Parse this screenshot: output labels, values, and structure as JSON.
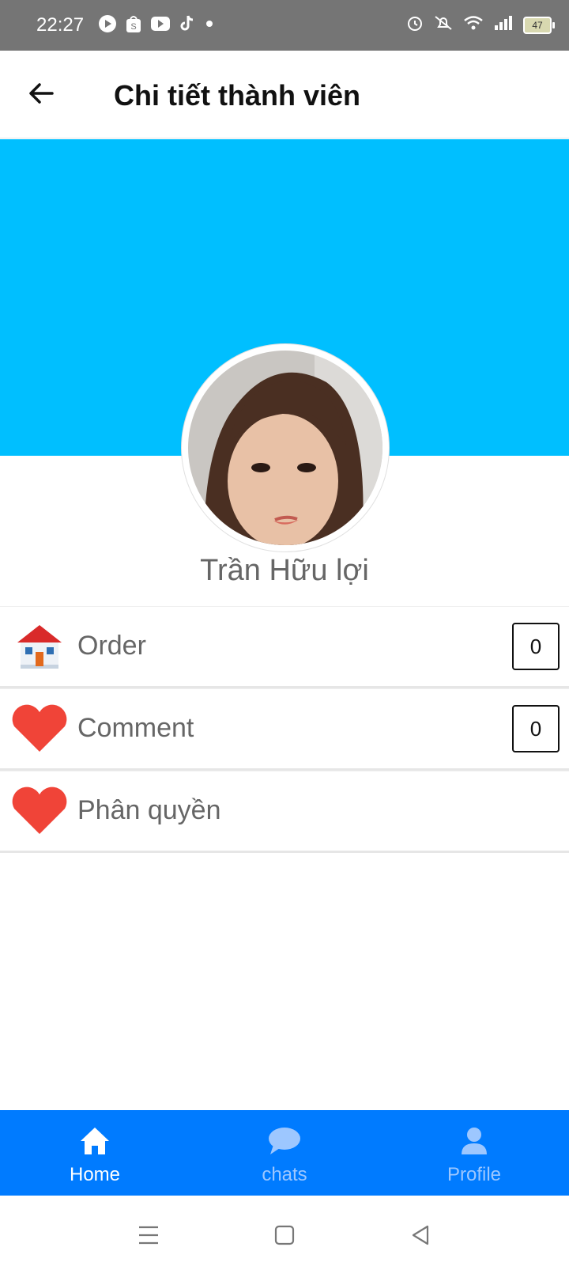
{
  "status_bar": {
    "time": "22:27",
    "battery": "47",
    "icons_left": [
      "play-icon",
      "shop-icon",
      "youtube-icon",
      "tiktok-icon",
      "dot-icon"
    ],
    "icons_right": [
      "alarm-icon",
      "mute-icon",
      "wifi-icon",
      "signal-icon",
      "battery-icon"
    ]
  },
  "app_bar": {
    "back_icon": "arrow-left-icon",
    "title": "Chi tiết thành viên"
  },
  "profile": {
    "name": "Trần Hữu lợi",
    "cover_color": "#00bfff"
  },
  "list": {
    "items": [
      {
        "label": "Order",
        "icon": "house-icon",
        "count": "0"
      },
      {
        "label": "Comment",
        "icon": "heart-icon",
        "count": "0"
      },
      {
        "label": "Phân quyền",
        "icon": "heart-icon"
      }
    ]
  },
  "bottom_nav": {
    "color": "#007bff",
    "items": [
      {
        "label": "Home",
        "icon": "home-icon",
        "active": true
      },
      {
        "label": "chats",
        "icon": "chat-bubble-icon",
        "active": false
      },
      {
        "label": "Profile",
        "icon": "person-icon",
        "active": false
      }
    ]
  },
  "system_nav": {
    "buttons": [
      "menu-icon",
      "square-home-icon",
      "triangle-back-icon"
    ]
  }
}
